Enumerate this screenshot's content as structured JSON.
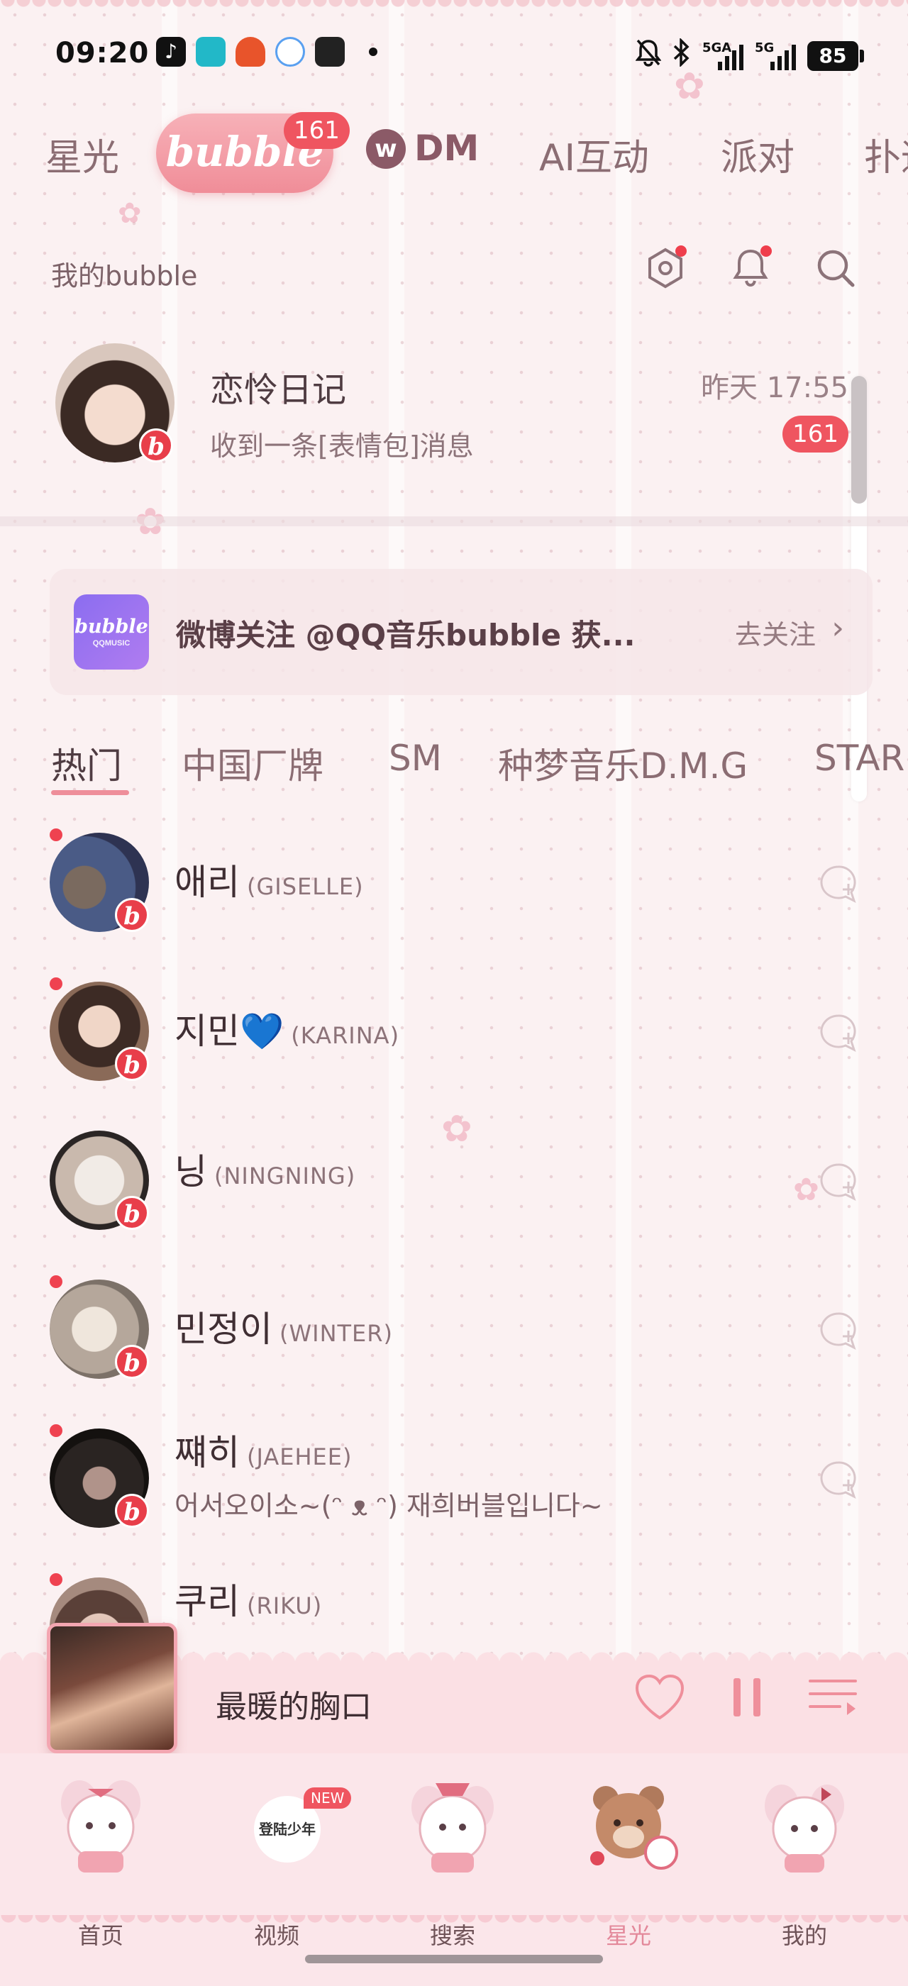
{
  "status_bar": {
    "time": "09:20",
    "signal_1_label": "5GA",
    "signal_2_label": "5G",
    "battery": "85",
    "icons": [
      "tiktok-icon",
      "app-icon",
      "app-icon",
      "app-icon",
      "app-icon",
      "notifications-muted-icon",
      "bluetooth-icon"
    ]
  },
  "top_nav": {
    "items": [
      "星光",
      "bubble",
      "DM",
      "AI互动",
      "派对",
      "扑通"
    ],
    "active": "bubble",
    "bubble_badge": "161",
    "dm_logo_letter": "w"
  },
  "section": {
    "title": "我的bubble"
  },
  "top_chat": {
    "name": "恋怜日记",
    "message": "收到一条[表情包]消息",
    "time": "昨天 17:55",
    "badge": "161",
    "badge_letter": "b"
  },
  "promo": {
    "logo_text": "bubble",
    "logo_sub": "QQMUSIC",
    "text": "微博关注 @QQ音乐bubble 获...",
    "link": "去关注"
  },
  "category_tabs": [
    "热门",
    "中国厂牌",
    "SM",
    "种梦音乐D.M.G",
    "STAR"
  ],
  "artists": [
    {
      "name": "애리",
      "english": "(GISELLE)",
      "subtitle": ""
    },
    {
      "name": "지민",
      "emoji": "💙",
      "english": "(KARINA)",
      "subtitle": ""
    },
    {
      "name": "닝",
      "english": "(NINGNING)",
      "subtitle": ""
    },
    {
      "name": "민정이",
      "english": "(WINTER)",
      "subtitle": ""
    },
    {
      "name": "쨰히",
      "english": "(JAEHEE)",
      "subtitle": "어서오이소~(ᵔ ᴥ ᵔ) 재희버블입니다~"
    },
    {
      "name": "쿠리",
      "english": "(RIKU)",
      "subtitle": ""
    }
  ],
  "player": {
    "title": "最暖的胸口"
  },
  "bottom_nav": {
    "items": [
      "首页",
      "视频",
      "搜索",
      "星光",
      "我的"
    ],
    "active": "星光",
    "video_badge": "NEW",
    "video_art_text": "登陆少年"
  },
  "colors": {
    "accent": "#ef5560",
    "bubble_pill": "#f4a0aa",
    "background": "#fbf1f2",
    "text_primary": "#3f2e33",
    "text_muted": "#8c7379"
  }
}
